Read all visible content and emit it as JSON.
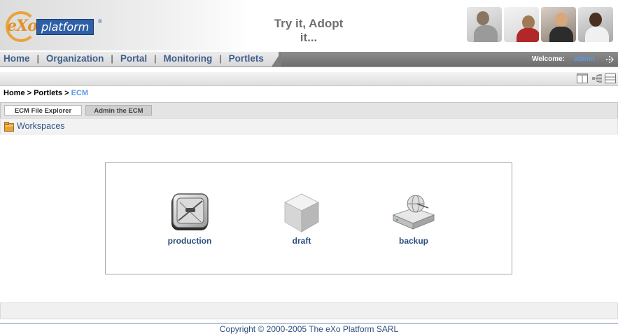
{
  "header": {
    "logo_text_exo": "eXo",
    "logo_text_platform": "platform",
    "logo_mark": "®",
    "tagline": "Try it, Adopt it..."
  },
  "nav": {
    "items": [
      {
        "label": "Home"
      },
      {
        "label": "Organization"
      },
      {
        "label": "Portal"
      },
      {
        "label": "Monitoring"
      },
      {
        "label": "Portlets"
      }
    ],
    "separator": "|",
    "welcome_label": "Welcome:",
    "username": "admin"
  },
  "toolbar": {
    "icons": [
      "layout-columns-icon",
      "tree-view-icon",
      "list-view-icon"
    ]
  },
  "breadcrumb": {
    "path": "Home > Portlets > ",
    "current": "ECM"
  },
  "tabs": [
    {
      "label": "ECM File Explorer",
      "active": true
    },
    {
      "label": "Admin the ECM",
      "active": false
    }
  ],
  "workspaces": {
    "label": "Workspaces",
    "items": [
      {
        "name": "production",
        "icon": "drive-icon"
      },
      {
        "name": "draft",
        "icon": "cube-icon"
      },
      {
        "name": "backup",
        "icon": "network-drive-icon"
      }
    ]
  },
  "footer": {
    "copyright": "Copyright © 2000-2005 The eXo Platform SARL"
  },
  "colors": {
    "nav_link": "#3f5f8c",
    "accent_blue": "#5a9ae8",
    "logo_orange": "#e3912a",
    "logo_blue": "#2f5fa8"
  }
}
